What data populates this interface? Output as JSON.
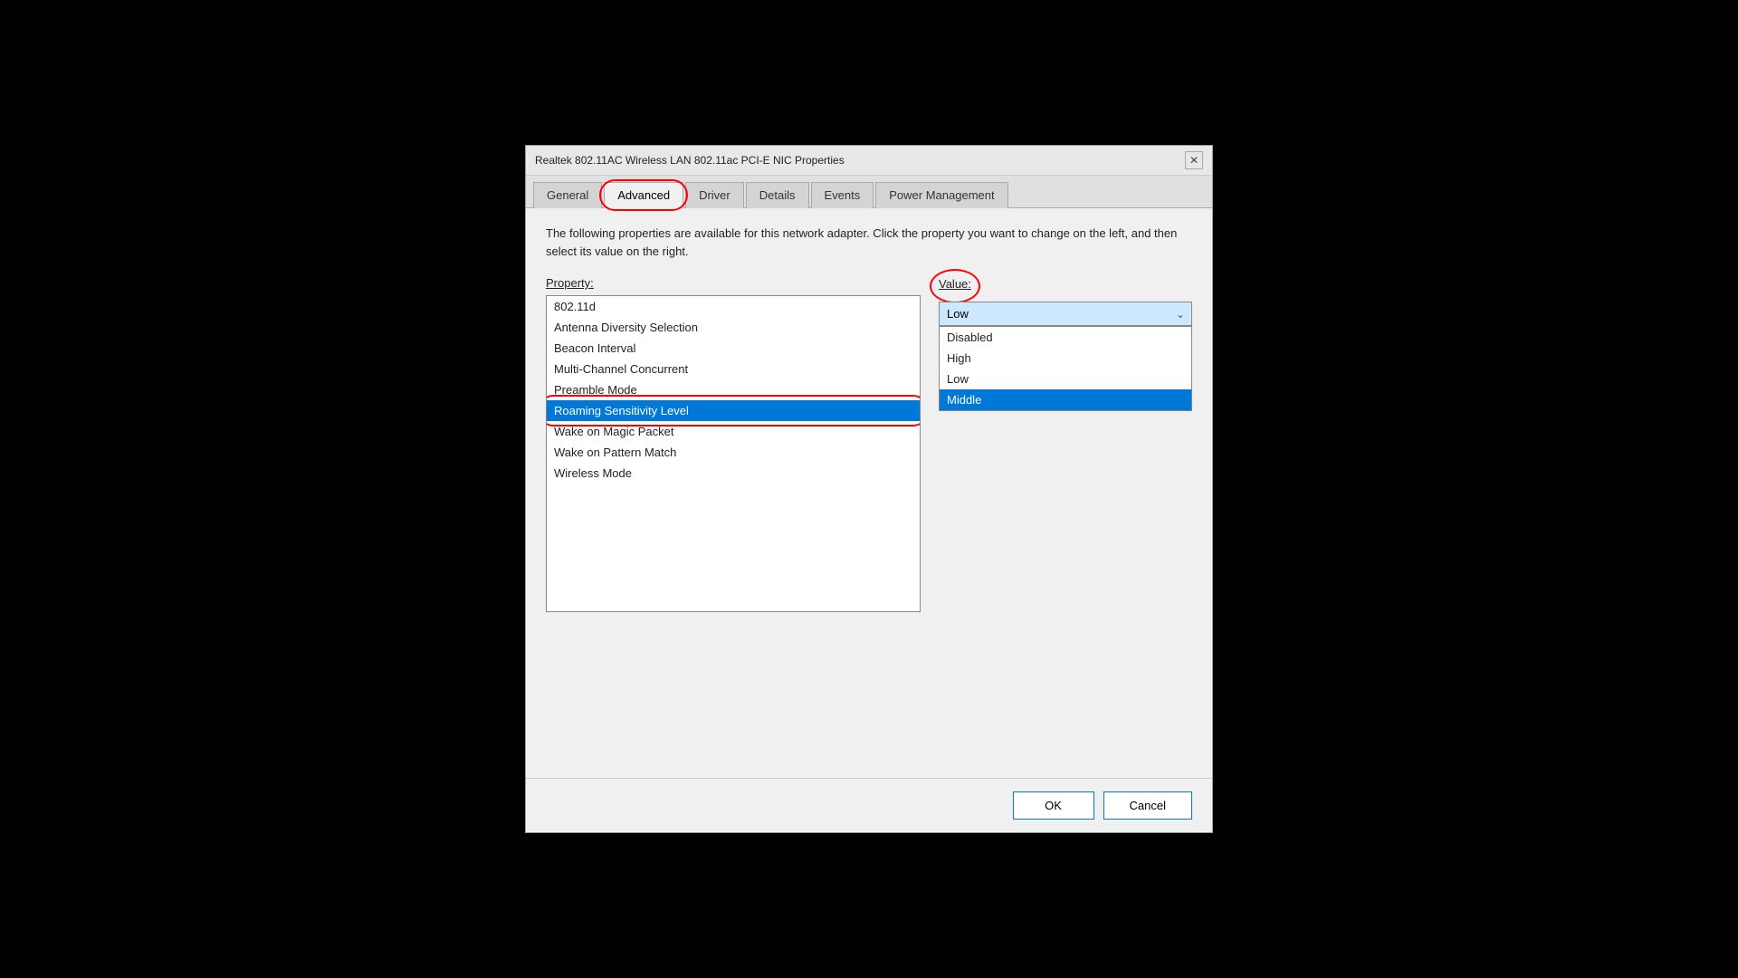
{
  "titleBar": {
    "title": "Realtek 802.11AC Wireless LAN 802.11ac PCI-E NIC Properties",
    "closeLabel": "✕"
  },
  "tabs": [
    {
      "id": "general",
      "label": "General",
      "active": false,
      "highlighted": false
    },
    {
      "id": "advanced",
      "label": "Advanced",
      "active": true,
      "highlighted": true
    },
    {
      "id": "driver",
      "label": "Driver",
      "active": false,
      "highlighted": false
    },
    {
      "id": "details",
      "label": "Details",
      "active": false,
      "highlighted": false
    },
    {
      "id": "events",
      "label": "Events",
      "active": false,
      "highlighted": false
    },
    {
      "id": "power-management",
      "label": "Power Management",
      "active": false,
      "highlighted": false
    }
  ],
  "description": "The following properties are available for this network adapter. Click the property you want to change on the left, and then select its value on the right.",
  "propertyLabel": "Property:",
  "valueLabel": "Value:",
  "properties": [
    {
      "id": "802-11d",
      "label": "802.11d",
      "selected": false
    },
    {
      "id": "antenna-diversity",
      "label": "Antenna Diversity Selection",
      "selected": false
    },
    {
      "id": "beacon-interval",
      "label": "Beacon Interval",
      "selected": false
    },
    {
      "id": "multi-channel",
      "label": "Multi-Channel Concurrent",
      "selected": false
    },
    {
      "id": "preamble-mode",
      "label": "Preamble Mode",
      "selected": false
    },
    {
      "id": "roaming-sensitivity",
      "label": "Roaming Sensitivity Level",
      "selected": true
    },
    {
      "id": "wake-magic",
      "label": "Wake on Magic Packet",
      "selected": false
    },
    {
      "id": "wake-pattern",
      "label": "Wake on Pattern Match",
      "selected": false
    },
    {
      "id": "wireless-mode",
      "label": "Wireless Mode",
      "selected": false
    }
  ],
  "valueDropdown": {
    "selectedValue": "Low",
    "options": [
      {
        "id": "disabled",
        "label": "Disabled",
        "selected": false
      },
      {
        "id": "high",
        "label": "High",
        "selected": false
      },
      {
        "id": "low",
        "label": "Low",
        "selected": false
      },
      {
        "id": "middle",
        "label": "Middle",
        "selected": true
      }
    ]
  },
  "footer": {
    "okLabel": "OK",
    "cancelLabel": "Cancel"
  }
}
